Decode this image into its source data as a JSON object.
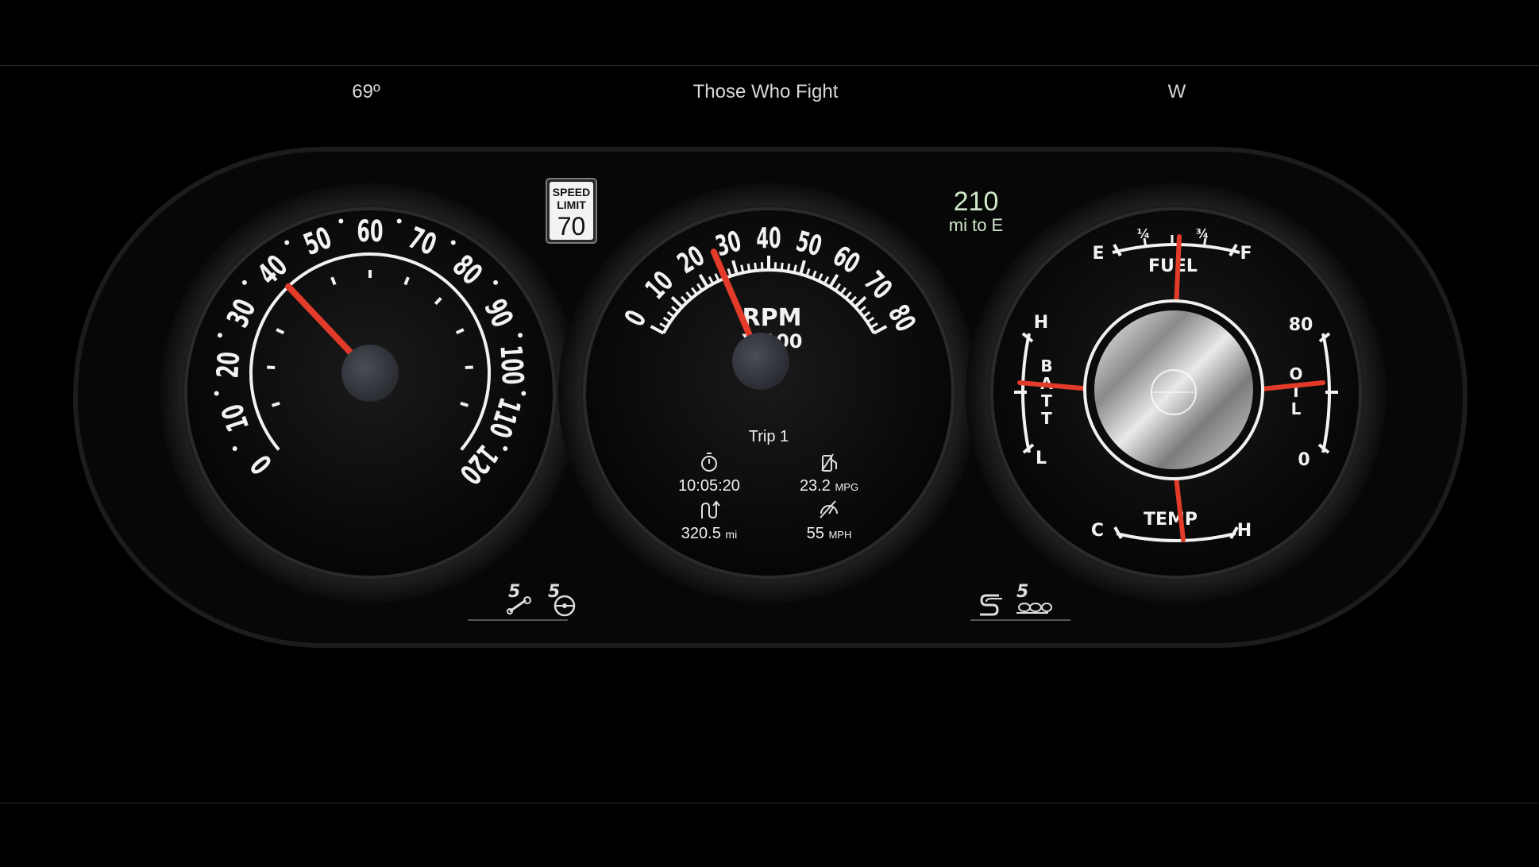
{
  "header": {
    "temperature": "69º",
    "media_title": "Those Who Fight",
    "compass": "W"
  },
  "speed_limit": {
    "line1": "SPEED",
    "line2": "LIMIT",
    "value": "70"
  },
  "range": {
    "value": "210",
    "label": "mi to E"
  },
  "speedometer": {
    "labels": [
      "0",
      "10",
      "20",
      "30",
      "40",
      "50",
      "60",
      "70",
      "80",
      "90",
      "100",
      "110",
      "120"
    ],
    "min": 0,
    "max": 120,
    "value": 40
  },
  "tachometer": {
    "labels": [
      "0",
      "10",
      "20",
      "30",
      "40",
      "50",
      "60",
      "70",
      "80"
    ],
    "title": "RPM",
    "subtitle": "X 100",
    "min": 0,
    "max": 80,
    "value": 25
  },
  "trip": {
    "title": "Trip 1",
    "elapsed_time": "10:05:20",
    "fuel_economy_value": "23.2",
    "fuel_economy_unit": "MPG",
    "distance_value": "320.5",
    "distance_unit": "mi",
    "avg_speed_value": "55",
    "avg_speed_unit": "MPH"
  },
  "aux_gauge": {
    "fuel": {
      "label": "FUEL",
      "empty": "E",
      "quarter": "¼",
      "three_quarter": "¾",
      "full": "F"
    },
    "battery": {
      "label": [
        "B",
        "A",
        "T",
        "T"
      ],
      "high": "H",
      "low": "L"
    },
    "oil": {
      "label": [
        "O",
        "I",
        "L"
      ],
      "high": "80",
      "low": "0"
    },
    "temp": {
      "label": "TEMP",
      "cold": "C",
      "hot": "H"
    }
  },
  "icons": {
    "left": [
      "s-traction-icon",
      "s-steering-icon"
    ],
    "right": [
      "s-mode-icon",
      "s-exhaust-icon"
    ]
  },
  "colors": {
    "needle": "#e23b2a",
    "range_text": "#cfe8c8",
    "background": "#000000"
  }
}
